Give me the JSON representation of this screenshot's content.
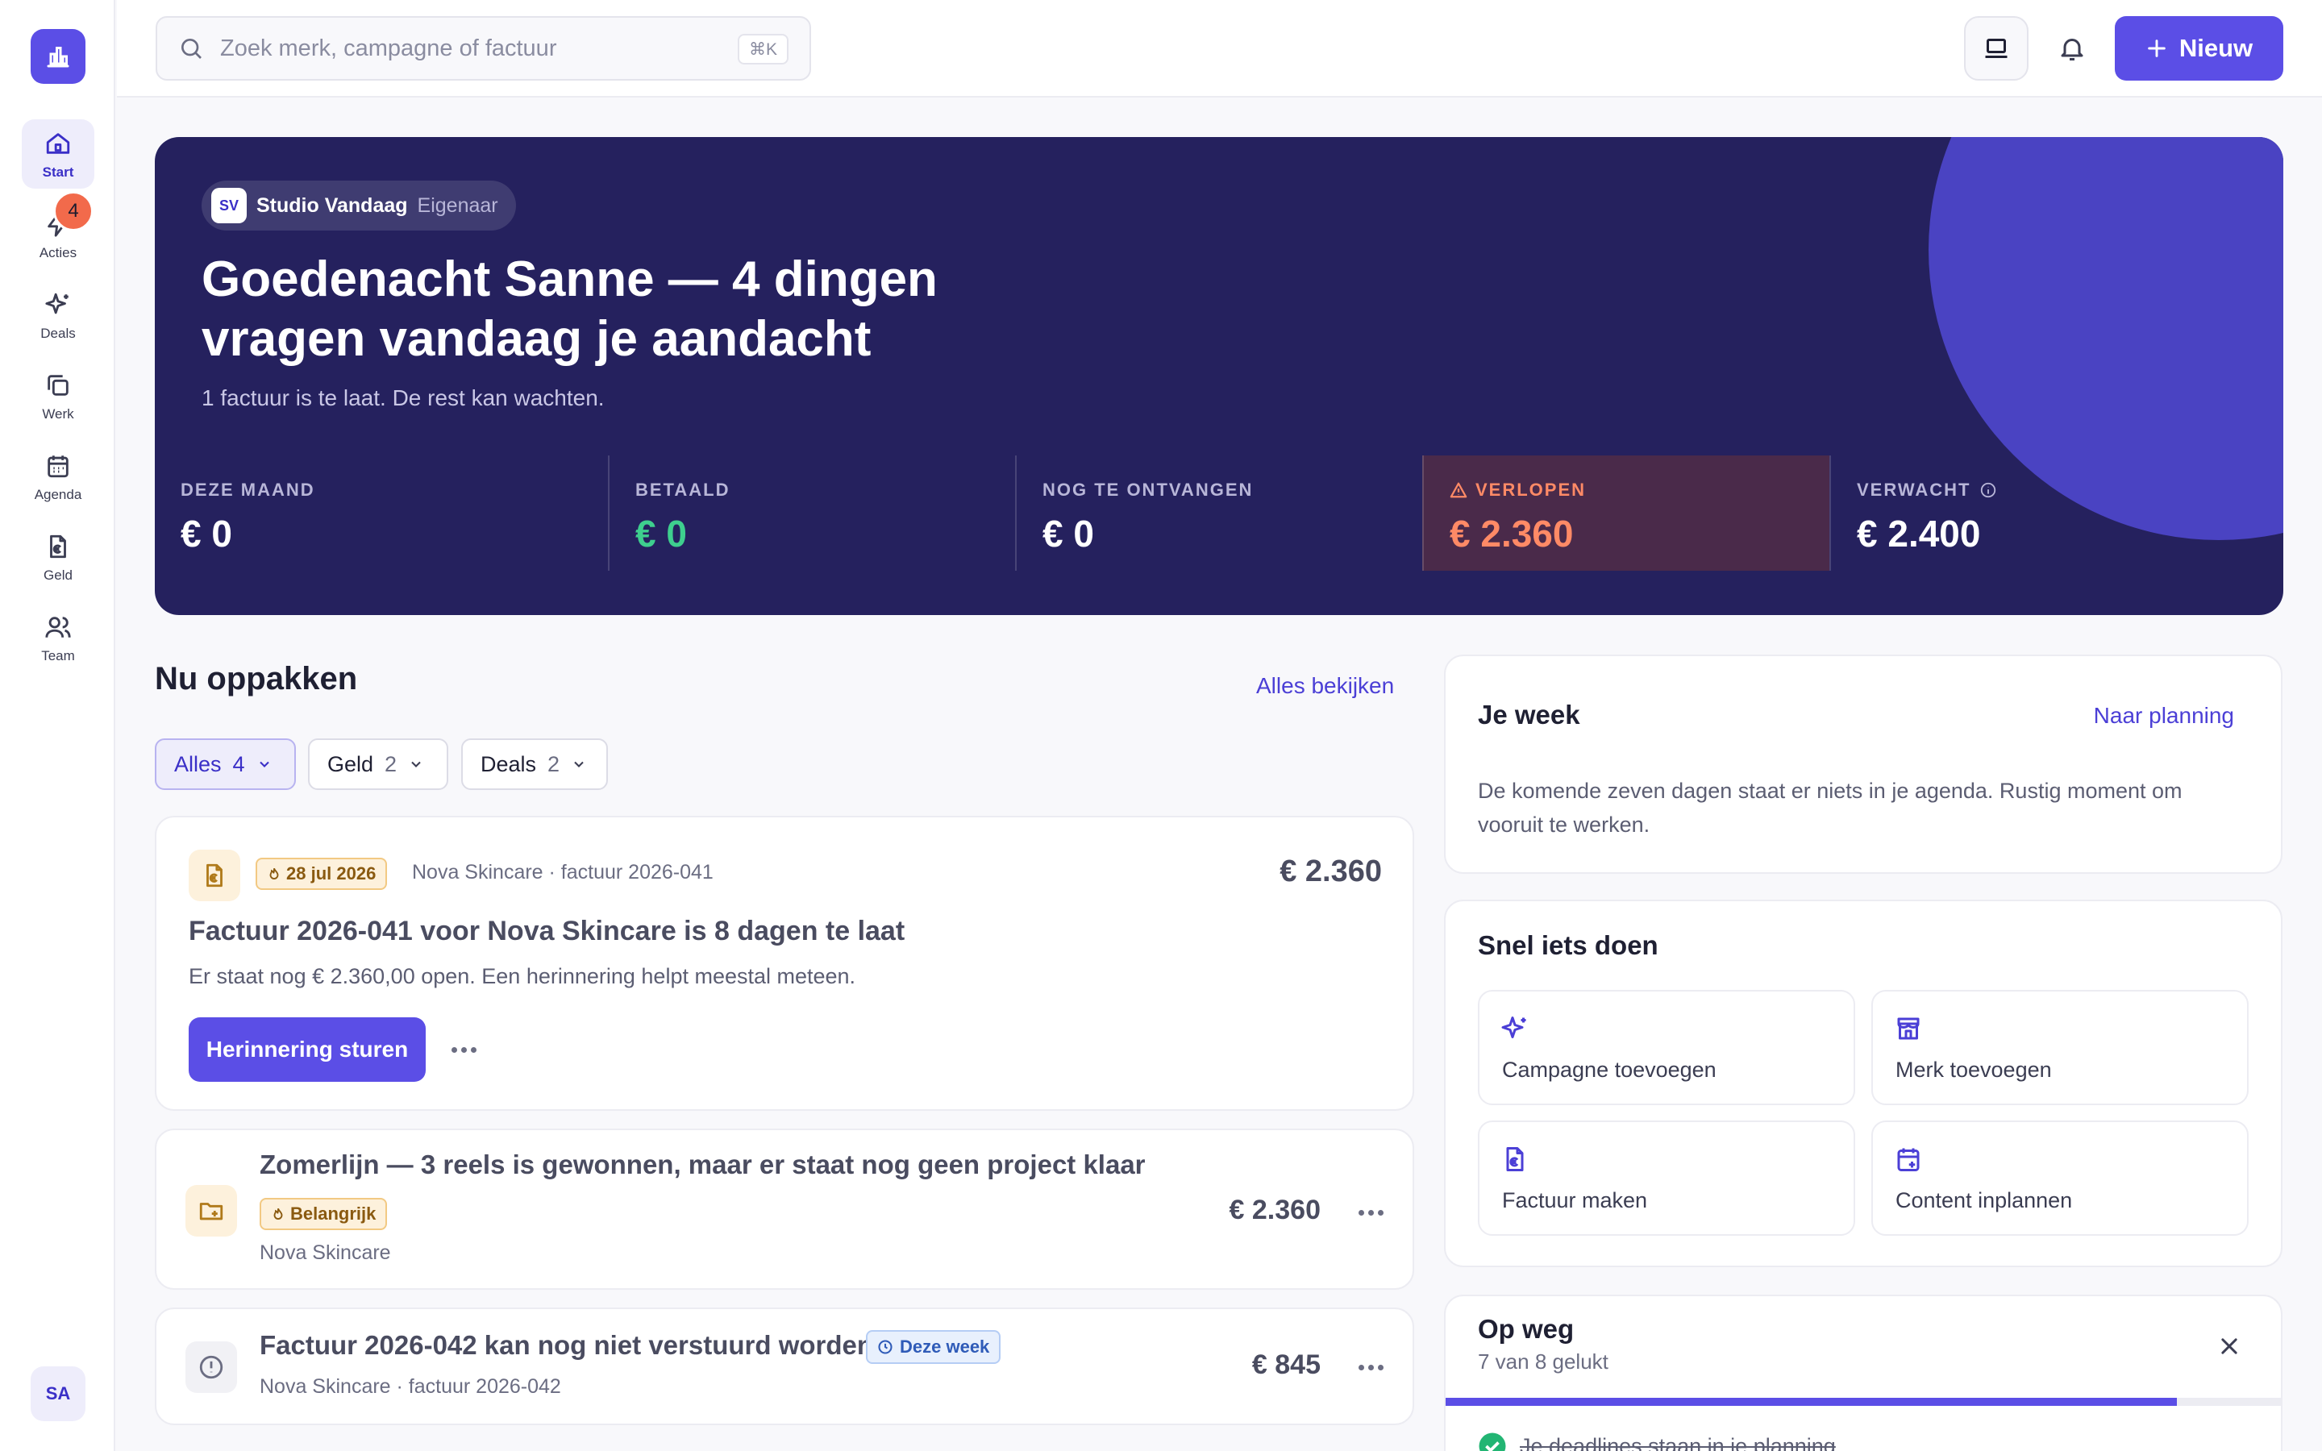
{
  "sidebar": {
    "items": [
      {
        "label": "Start"
      },
      {
        "label": "Acties",
        "badge": "4"
      },
      {
        "label": "Deals"
      },
      {
        "label": "Werk"
      },
      {
        "label": "Agenda"
      },
      {
        "label": "Geld"
      },
      {
        "label": "Team"
      }
    ],
    "avatar": "SA"
  },
  "topbar": {
    "search_placeholder": "Zoek merk, campagne of factuur",
    "shortcut": "⌘K",
    "new_label": "Nieuw"
  },
  "hero": {
    "org_initials": "SV",
    "org_name": "Studio Vandaag",
    "role": "Eigenaar",
    "title": "Goedenacht Sanne — 4 dingen vragen vandaag je aandacht",
    "subtitle": "1 factuur is te laat. De rest kan wachten.",
    "stats": [
      {
        "label": "DEZE MAAND",
        "value": "€ 0"
      },
      {
        "label": "BETAALD",
        "value": "€ 0"
      },
      {
        "label": "NOG TE ONTVANGEN",
        "value": "€ 0"
      },
      {
        "label": "VERLOPEN",
        "value": "€ 2.360"
      },
      {
        "label": "VERWACHT",
        "value": "€ 2.400"
      }
    ]
  },
  "todo": {
    "title": "Nu oppakken",
    "view_all": "Alles bekijken",
    "filters": [
      {
        "label": "Alles",
        "count": "4"
      },
      {
        "label": "Geld",
        "count": "2"
      },
      {
        "label": "Deals",
        "count": "2"
      }
    ],
    "items": [
      {
        "date": "28 jul 2026",
        "meta": "Nova Skincare · factuur 2026-041",
        "amount": "€ 2.360",
        "title": "Factuur 2026-041 voor Nova Skincare is 8 dagen te laat",
        "desc": "Er staat nog € 2.360,00 open. Een herinnering helpt meestal meteen.",
        "action": "Herinnering sturen"
      },
      {
        "title": "Zomerlijn — 3 reels is gewonnen, maar er staat nog geen project klaar",
        "tag": "Belangrijk",
        "meta": "Nova Skincare",
        "amount": "€ 2.360"
      },
      {
        "title": "Factuur 2026-042 kan nog niet verstuurd worden",
        "tag": "Deze week",
        "meta": "Nova Skincare · factuur 2026-042",
        "amount": "€ 845"
      }
    ]
  },
  "week": {
    "title": "Je week",
    "link": "Naar planning",
    "text": "De komende zeven dagen staat er niets in je agenda. Rustig moment om vooruit te werken."
  },
  "quick": {
    "title": "Snel iets doen",
    "actions": [
      {
        "label": "Campagne toevoegen",
        "icon": "sparkle-icon"
      },
      {
        "label": "Merk toevoegen",
        "icon": "store-icon"
      },
      {
        "label": "Factuur maken",
        "icon": "invoice-icon"
      },
      {
        "label": "Content inplannen",
        "icon": "calendar-plus-icon"
      }
    ]
  },
  "onboarding": {
    "title": "Op weg",
    "subtitle": "7 van 8 gelukt",
    "progress": 0.875,
    "first_step": "Je deadlines staan in je planning"
  },
  "colors": {
    "accent": "#5b4ee6",
    "hero": "#25215e",
    "danger": "#ff8a66",
    "success": "#3ecf8e"
  }
}
